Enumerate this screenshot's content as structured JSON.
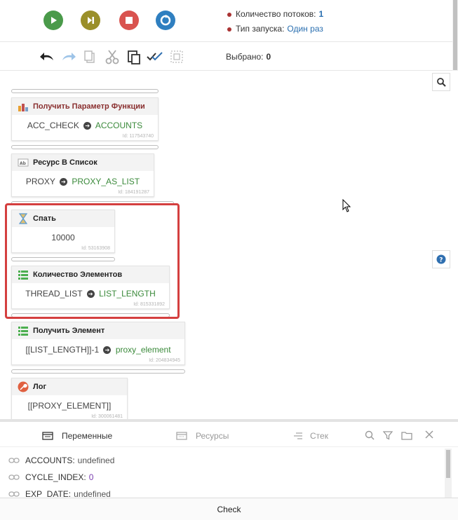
{
  "topbar": {
    "threads_label": "Количество потоков:",
    "threads_value": "1",
    "launch_label": "Тип запуска:",
    "launch_value": "Один раз"
  },
  "toolbar": {
    "selected_label": "Выбрано:",
    "selected_value": "0"
  },
  "blocks": [
    {
      "title": "Получить Параметр Функции",
      "from": "ACC_CHECK",
      "to": "ACCOUNTS",
      "id": "Id: 117543740",
      "title_color": "#8a3030"
    },
    {
      "title": "Ресурс В Список",
      "from": "PROXY",
      "to": "PROXY_AS_LIST",
      "id": "Id: 184191287"
    },
    {
      "title": "Спать",
      "value": "10000",
      "id": "Id: 53163908"
    },
    {
      "title": "Количество Элементов",
      "from": "THREAD_LIST",
      "to": "LIST_LENGTH",
      "id": "Id: 815331892"
    },
    {
      "title": "Получить Элемент",
      "from": "[[LIST_LENGTH]]-1",
      "to": "proxy_element",
      "id": "Id: 204834945"
    },
    {
      "title": "Лог",
      "value": "[[PROXY_ELEMENT]]",
      "id": "Id: 300061481"
    }
  ],
  "bottom": {
    "tabs": [
      "Переменные",
      "Ресурсы",
      "Стек"
    ],
    "variables": [
      {
        "name": "ACCOUNTS:",
        "value": "undefined"
      },
      {
        "name": "CYCLE_INDEX:",
        "value": "0"
      },
      {
        "name": "EXP_DATE:",
        "value": "undefined"
      }
    ],
    "check_label": "Check"
  },
  "colors": {
    "play": "#4a9a4a",
    "step": "#9a8f2a",
    "stop": "#d9534f",
    "restart": "#2f7fc0",
    "highlight": "#d43f3f",
    "target_var": "#3b8a3b"
  }
}
